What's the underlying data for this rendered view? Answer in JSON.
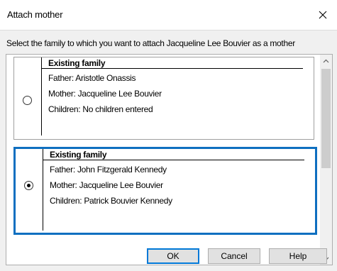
{
  "window": {
    "title": "Attach mother"
  },
  "prompt": "Select the family to which you want to attach Jacqueline Lee Bouvier as a mother",
  "families": [
    {
      "header": "Existing family",
      "father": "Father: Aristotle Onassis",
      "mother": "Mother: Jacqueline Lee Bouvier",
      "children": "Children: No children entered",
      "selected": false
    },
    {
      "header": "Existing family",
      "father": "Father: John Fitzgerald Kennedy",
      "mother": "Mother: Jacqueline Lee Bouvier",
      "children": "Children: Patrick Bouvier Kennedy",
      "selected": true
    }
  ],
  "buttons": {
    "ok": "OK",
    "cancel": "Cancel",
    "help": "Help"
  },
  "icons": {
    "close": "close-icon",
    "scroll_up": "chevron-up-icon",
    "scroll_down": "chevron-down-icon"
  },
  "colors": {
    "selection_border": "#0e6fc0",
    "default_button_border": "#0078d7",
    "dialog_background": "#f0f0f0"
  }
}
